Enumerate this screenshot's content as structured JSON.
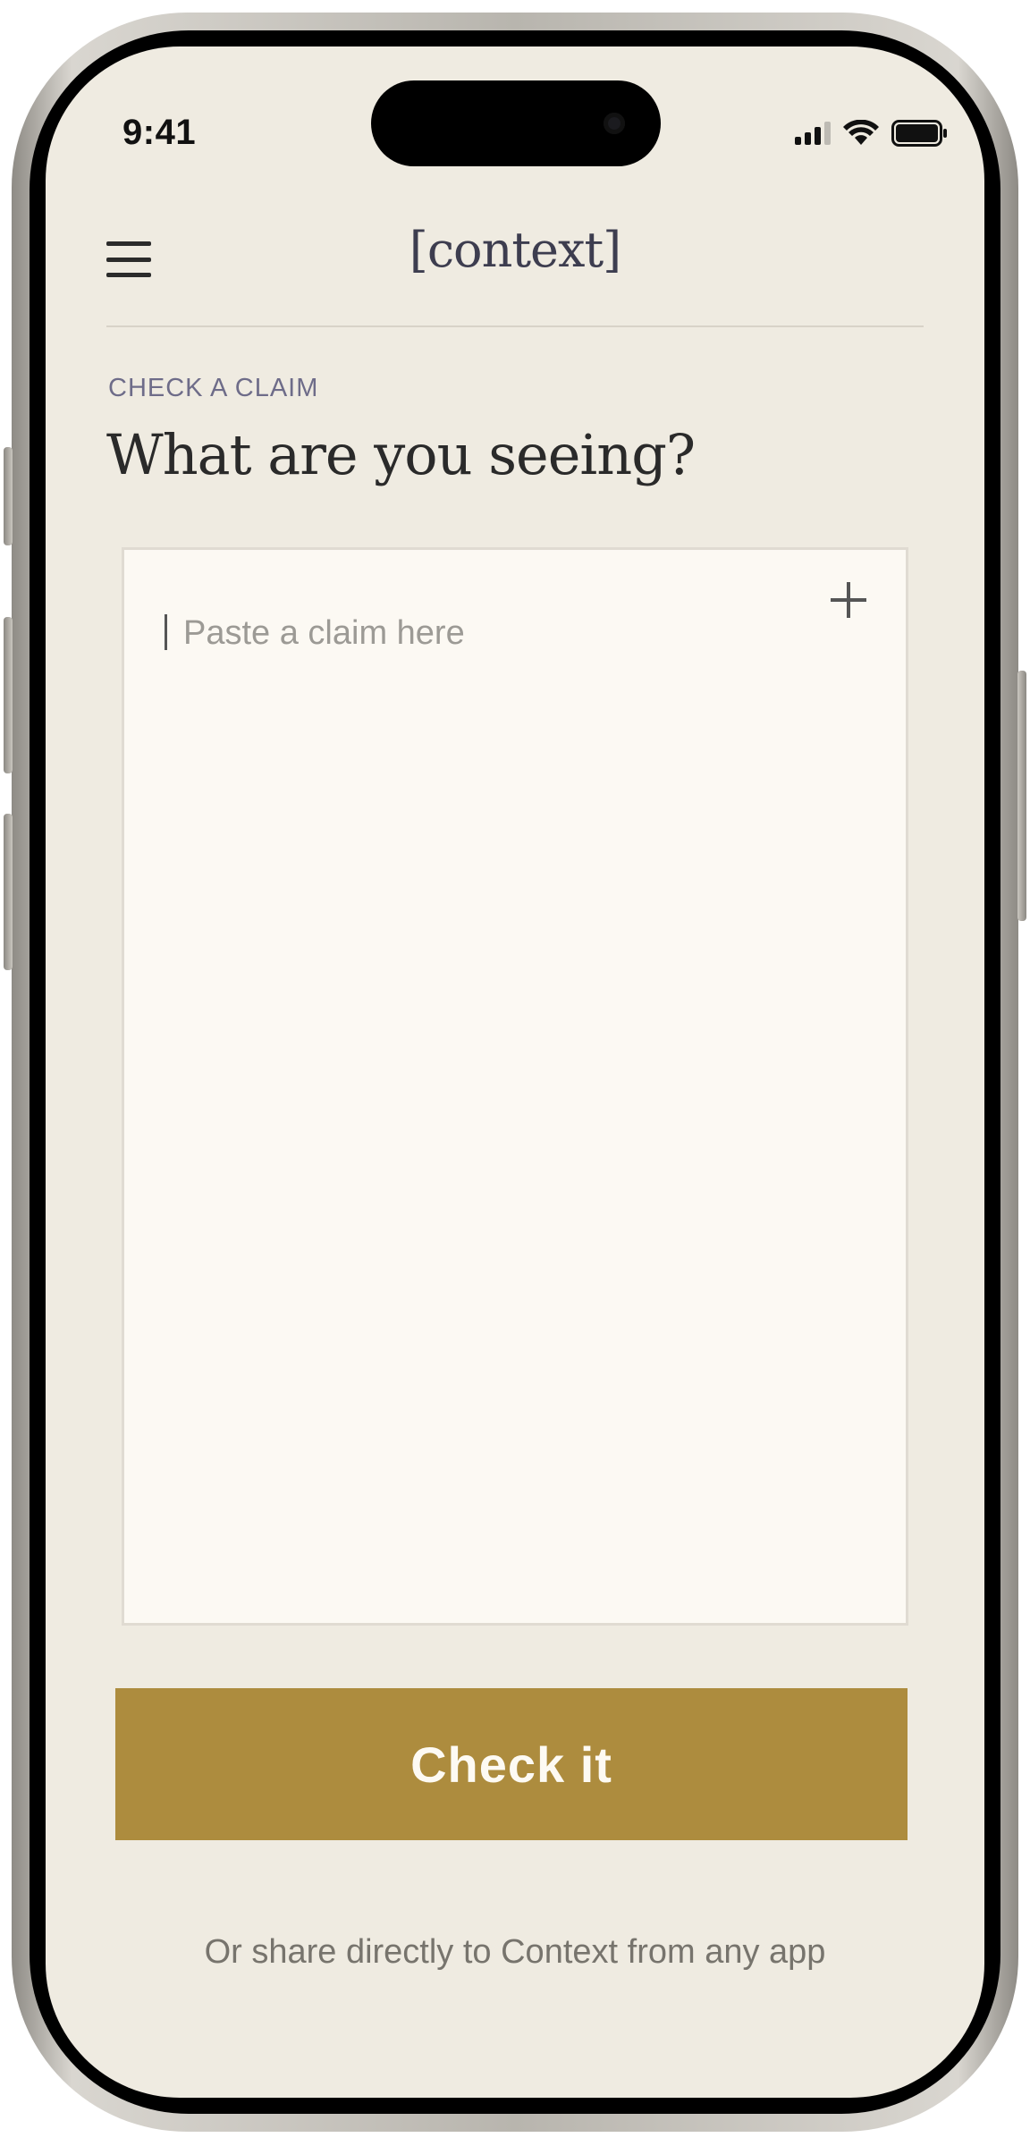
{
  "status_bar": {
    "time": "9:41",
    "icons": [
      "cellular-signal-icon",
      "wifi-icon",
      "battery-icon"
    ]
  },
  "header": {
    "menu_icon": "hamburger-menu-icon",
    "brand": "[context]"
  },
  "main": {
    "section_label": "CHECK A CLAIM",
    "title": "What are you seeing?",
    "claim_input": {
      "value": "",
      "placeholder": "Paste a claim here",
      "add_icon": "plus-icon"
    },
    "check_button_label": "Check it",
    "share_hint": "Or share directly to Context from any app"
  },
  "colors": {
    "background": "#efebe1",
    "input_background": "#fcf9f3",
    "accent_button": "#ad8c3e",
    "brand_text": "#3d3d4f",
    "label_text": "#6e6c89"
  }
}
